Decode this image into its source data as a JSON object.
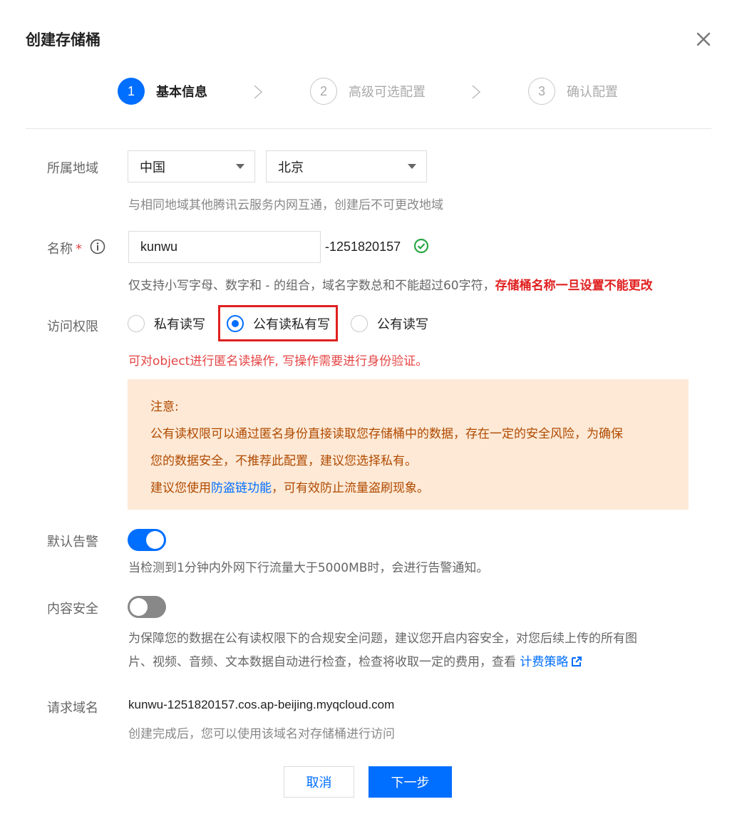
{
  "dialog": {
    "title": "创建存储桶"
  },
  "steps": [
    {
      "number": "1",
      "label": "基本信息"
    },
    {
      "number": "2",
      "label": "高级可选配置"
    },
    {
      "number": "3",
      "label": "确认配置"
    }
  ],
  "region": {
    "label": "所属地域",
    "country": "中国",
    "city": "北京",
    "hint": "与相同地域其他腾讯云服务内网互通，创建后不可更改地域"
  },
  "name": {
    "label": "名称",
    "required_mark": "*",
    "value": "kunwu",
    "suffix": "-1251820157",
    "hint_normal": "仅支持小写字母、数字和 - 的组合，域名字数总和不能超过60字符，",
    "hint_warning": "存储桶名称一旦设置不能更改"
  },
  "access": {
    "label": "访问权限",
    "options": [
      "私有读写",
      "公有读私有写",
      "公有读写"
    ],
    "selected": "公有读私有写",
    "description": "可对object进行匿名读操作, 写操作需要进行身份验证。"
  },
  "notice": {
    "title": "注意:",
    "line1": "公有读权限可以通过匿名身份直接读取您存储桶中的数据，存在一定的安全风险，为确保",
    "line2": "您的数据安全，不推荐此配置，建议您选择私有。",
    "line3_prefix": "建议您使用",
    "line3_link": "防盗链功能",
    "line3_suffix": "，可有效防止流量盗刷现象。"
  },
  "alarm": {
    "label": "默认告警",
    "enabled": true,
    "hint": "当检测到1分钟内外网下行流量大于5000MB时，会进行告警通知。"
  },
  "content_security": {
    "label": "内容安全",
    "enabled": false,
    "desc_line1": "为保障您的数据在公有读权限下的合规安全问题，建议您开启内容安全，对您后续上传的所有图",
    "desc_line2": "片、视频、音频、文本数据自动进行检查，检查将收取一定的费用，查看 ",
    "link": "计费策略"
  },
  "domain": {
    "label": "请求域名",
    "value": "kunwu-1251820157.cos.ap-beijing.myqcloud.com",
    "hint": "创建完成后，您可以使用该域名对存储桶进行访问"
  },
  "buttons": {
    "cancel": "取消",
    "next": "下一步"
  },
  "colors": {
    "primary": "#006eff",
    "danger": "#e54545",
    "notice_bg": "#fde9d6",
    "success": "#29a745"
  }
}
